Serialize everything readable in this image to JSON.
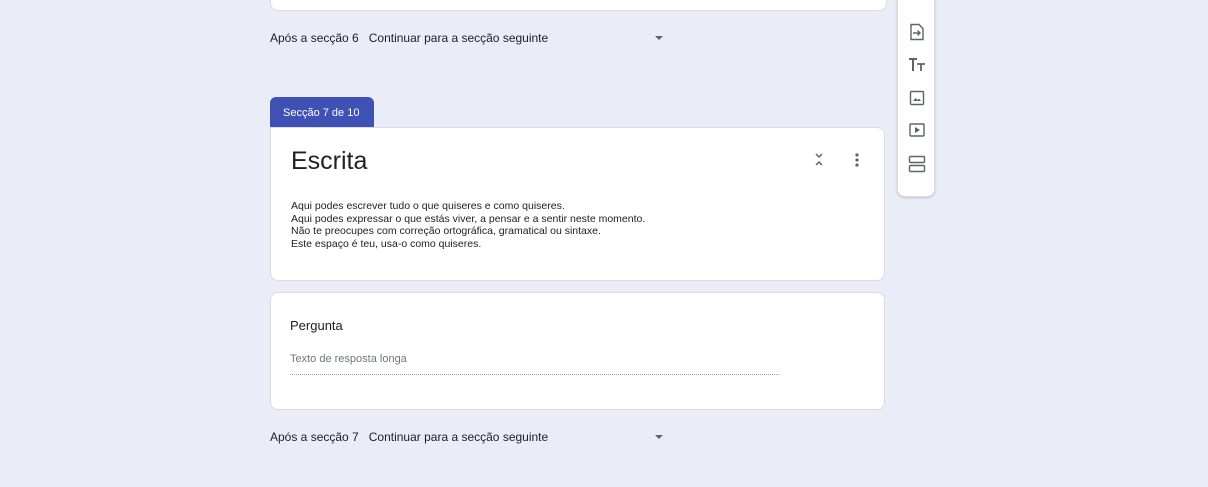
{
  "section6_footer": {
    "label": "Após a secção 6",
    "selected": "Continuar para a secção seguinte"
  },
  "section": {
    "tab_label": "Secção 7 de 10",
    "title": "Escrita",
    "description": [
      "Aqui podes escrever tudo o que quiseres e como quiseres.",
      "Aqui podes expressar o que estás viver, a pensar e a sentir neste momento.",
      "Não te preocupes com correção ortográfica, gramatical ou sintaxe.",
      "Este espaço é teu, usa-o como quiseres."
    ]
  },
  "question": {
    "title": "Pergunta",
    "placeholder": "Texto de resposta longa"
  },
  "section7_footer": {
    "label": "Após a secção 7",
    "selected": "Continuar para a secção seguinte"
  },
  "toolbar": {
    "icons": [
      "import-questions-icon",
      "add-title-icon",
      "add-image-icon",
      "add-video-icon",
      "add-section-icon"
    ]
  },
  "colors": {
    "background": "#eaedf7",
    "section_tab": "#3f51b5",
    "card": "#ffffff"
  }
}
